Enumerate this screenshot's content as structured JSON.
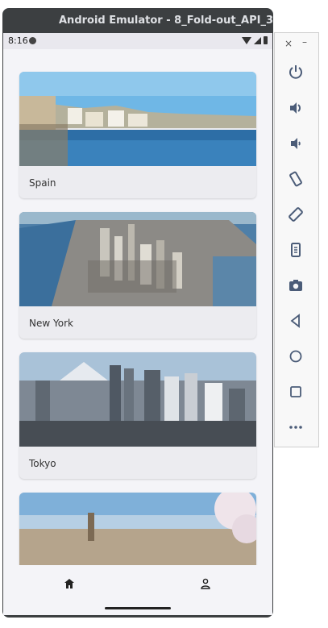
{
  "window": {
    "title": "Android Emulator - 8_Fold-out_API_3..."
  },
  "status": {
    "time": "8:16"
  },
  "cards": [
    {
      "label": "Spain"
    },
    {
      "label": "New York"
    },
    {
      "label": "Tokyo"
    },
    {
      "label": ""
    }
  ],
  "nav": {
    "items": [
      "home",
      "profile"
    ]
  },
  "panel": {
    "close": "×",
    "minimize": "–",
    "tools": [
      "power-icon",
      "volume-up-icon",
      "volume-down-icon",
      "rotate-left-icon",
      "rotate-right-icon",
      "screenshot-icon",
      "camera-icon",
      "back-icon",
      "home-circle-icon",
      "overview-icon",
      "more-icon"
    ]
  },
  "colors": {
    "accent": "#4b5c78",
    "nav_icon": "#222222"
  }
}
